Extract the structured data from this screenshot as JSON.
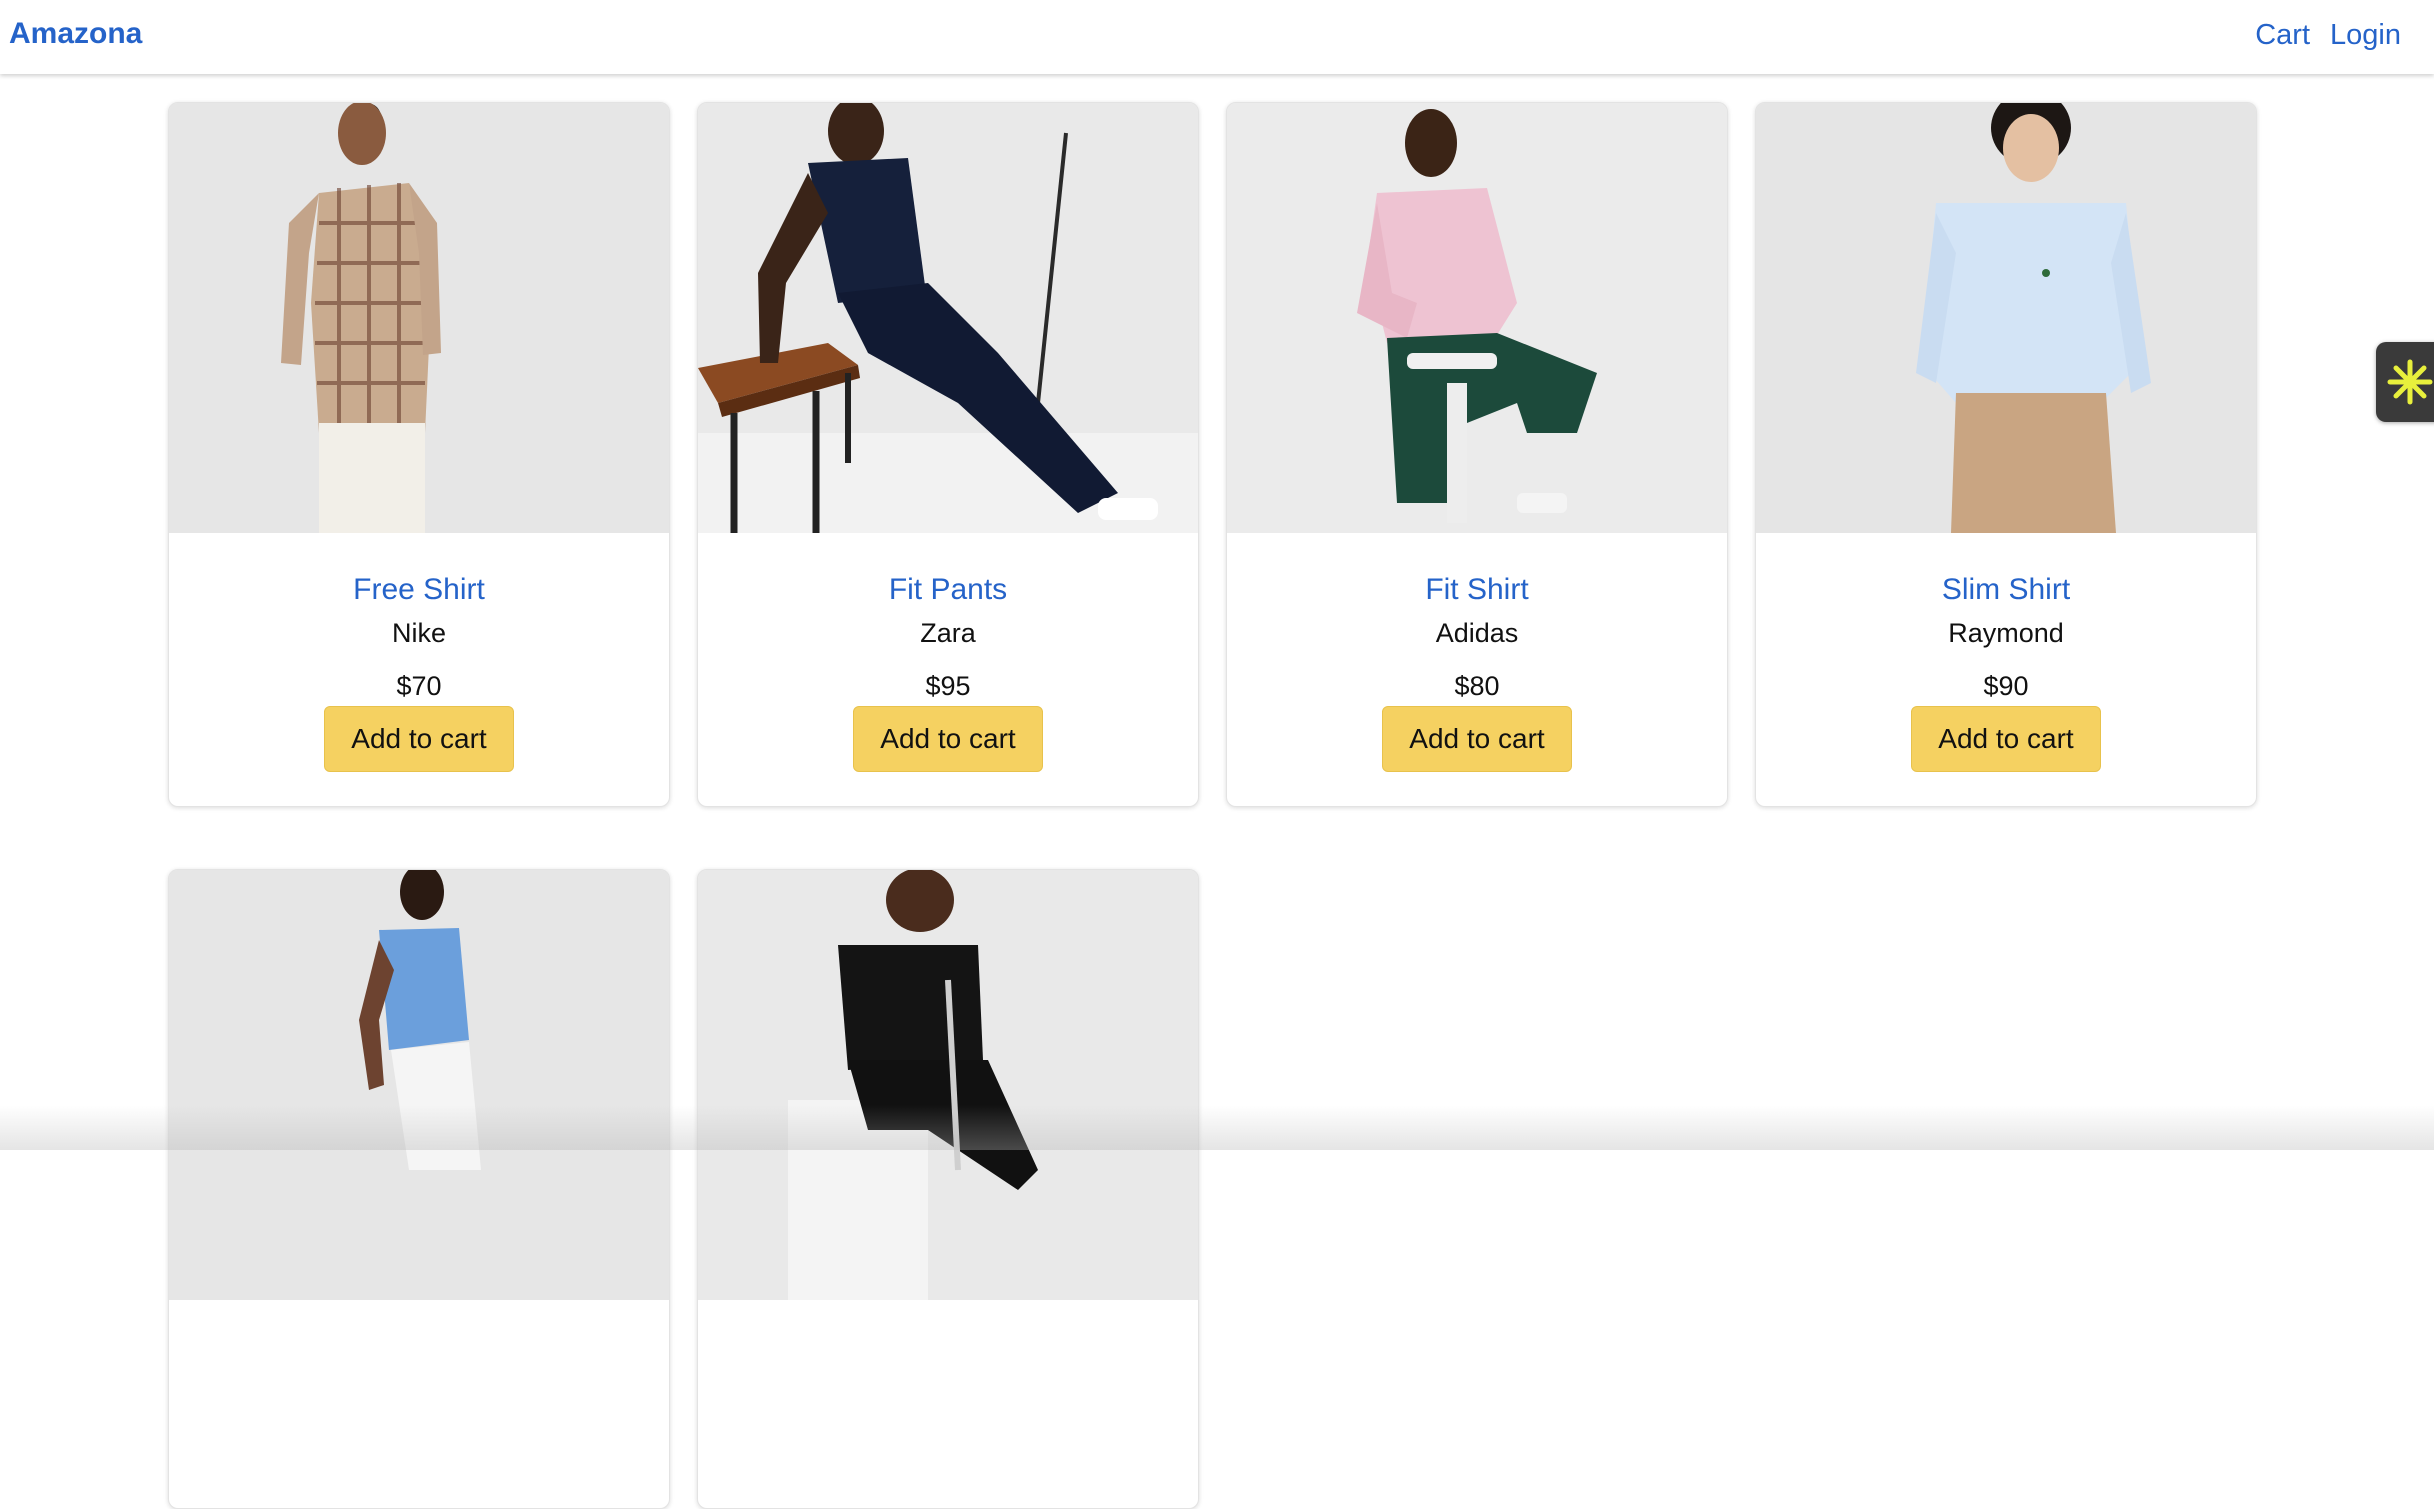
{
  "header": {
    "brand": "Amazona",
    "links": {
      "cart": "Cart",
      "login": "Login"
    }
  },
  "products": [
    {
      "name": "Free Shirt",
      "brand": "Nike",
      "price": "$70",
      "button": "Add to cart"
    },
    {
      "name": "Fit Pants",
      "brand": "Zara",
      "price": "$95",
      "button": "Add to cart"
    },
    {
      "name": "Fit Shirt",
      "brand": "Adidas",
      "price": "$80",
      "button": "Add to cart"
    },
    {
      "name": "Slim Shirt",
      "brand": "Raymond",
      "price": "$90",
      "button": "Add to cart"
    }
  ],
  "colors": {
    "link": "#2563c9",
    "button": "#f5d161",
    "widget": "#3a3a3a",
    "widget_icon": "#e8f03c"
  },
  "icons": {
    "side_widget": "asterisk-icon"
  }
}
